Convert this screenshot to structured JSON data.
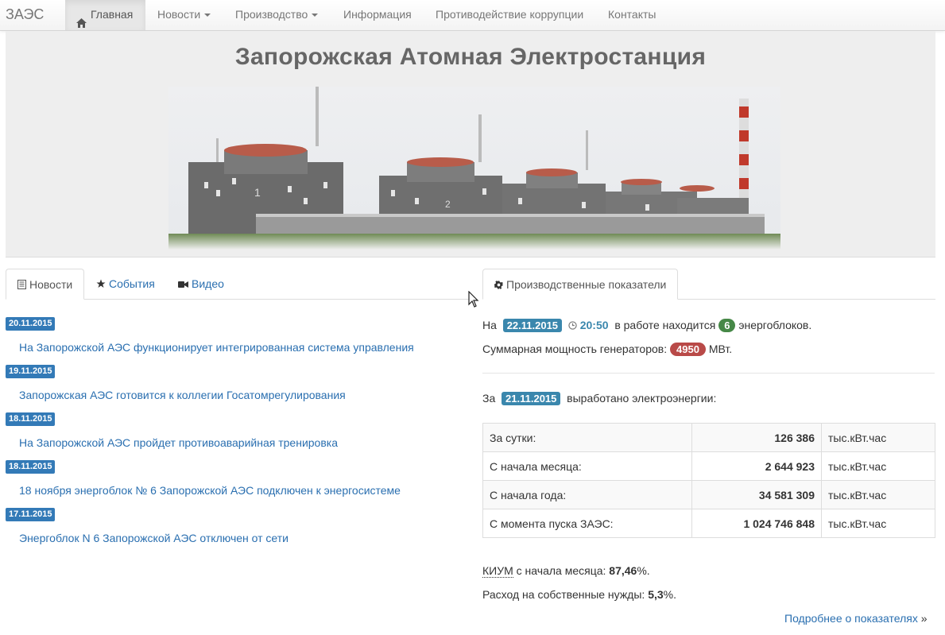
{
  "navbar": {
    "brand": "ЗАЭС",
    "items": [
      {
        "label": "Главная",
        "active": true,
        "icon": "home-icon"
      },
      {
        "label": "Новости",
        "dropdown": true
      },
      {
        "label": "Производство",
        "dropdown": true
      },
      {
        "label": "Информация"
      },
      {
        "label": "Противодействие коррупции"
      },
      {
        "label": "Контакты"
      }
    ]
  },
  "hero": {
    "title": "Запорожская Атомная Электростанция"
  },
  "left_tabs": [
    {
      "label": "Новости",
      "icon": "newspaper-icon",
      "active": true
    },
    {
      "label": "События",
      "icon": "star-icon"
    },
    {
      "label": "Видео",
      "icon": "video-camera-icon"
    }
  ],
  "news": [
    {
      "date": "20.11.2015",
      "title": "На Запорожской АЭС функционирует интегрированная система управления"
    },
    {
      "date": "19.11.2015",
      "title": "Запорожская АЭС готовится к коллегии Госатомрегулирования"
    },
    {
      "date": "18.11.2015",
      "title": "На Запорожской АЭС пройдет противоаварийная тренировка"
    },
    {
      "date": "18.11.2015",
      "title": "18 ноября энергоблок № 6 Запорожской АЭС подключен к энергосистеме"
    },
    {
      "date": "17.11.2015",
      "title": "Энергоблок N 6 Запорожской АЭС отключен от сети"
    }
  ],
  "right_tab": {
    "label": "Производственные показатели",
    "icon": "gear-icon"
  },
  "status": {
    "prefix": "На",
    "date": "22.11.2015",
    "time": "20:50",
    "mid": "в работе находится",
    "units": "6",
    "suffix": "энергоблоков.",
    "power_label": "Суммарная мощность генераторов:",
    "power": "4950",
    "power_unit": "МВт."
  },
  "output": {
    "prefix": "За",
    "date": "21.11.2015",
    "suffix": "выработано электроэнергии:",
    "rows": [
      {
        "label": "За сутки:",
        "value": "126 386",
        "unit": "тыс.кВт.час"
      },
      {
        "label": "С начала месяца:",
        "value": "2 644 923",
        "unit": "тыс.кВт.час"
      },
      {
        "label": "С начала года:",
        "value": "34 581 309",
        "unit": "тыс.кВт.час"
      },
      {
        "label": "С момента пуска ЗАЭС:",
        "value": "1 024 746 848",
        "unit": "тыс.кВт.час"
      }
    ]
  },
  "kium": {
    "abbr": "КИУМ",
    "text": "с начала месяца:",
    "value": "87,46",
    "unit": "%."
  },
  "own_needs": {
    "text": "Расход на собственные нужды:",
    "value": "5,3",
    "unit": "%."
  },
  "more_link": {
    "label": "Подробнее о показателях",
    "arrow": "»"
  },
  "colors": {
    "link": "#2a6fb0",
    "badge_blue": "#3a87ad",
    "badge_green": "#468847",
    "badge_red": "#b94a48"
  }
}
